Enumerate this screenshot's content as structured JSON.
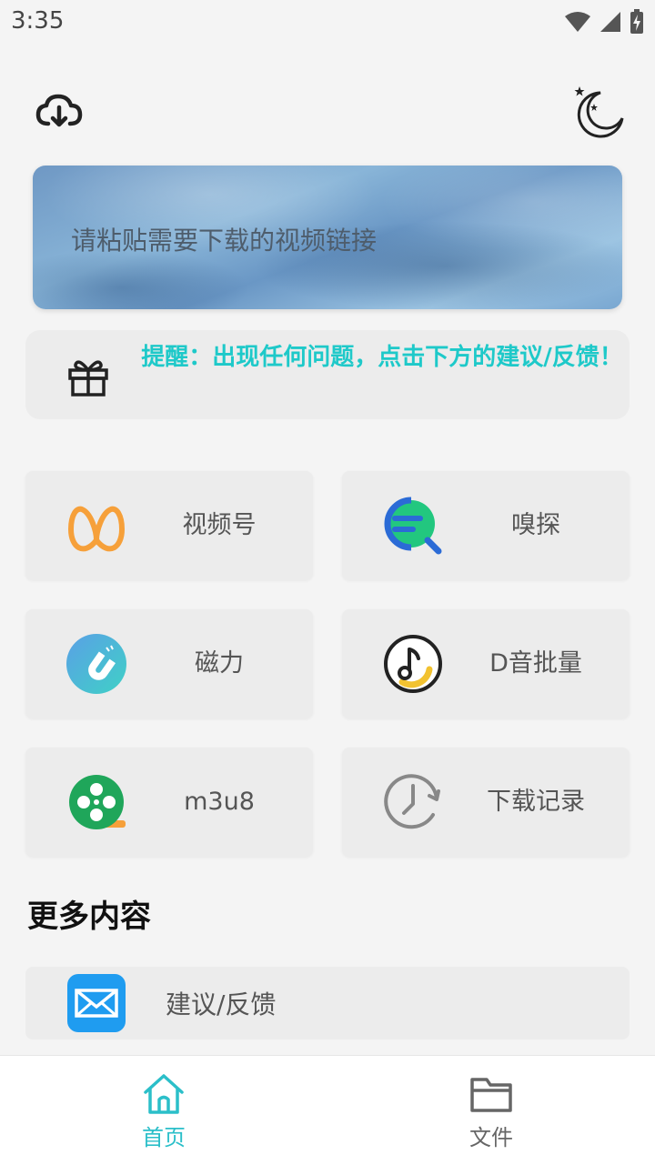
{
  "status_bar": {
    "time": "3:35"
  },
  "header": {
    "left_icon": "cloud-download-icon",
    "right_icon": "night-mode-moon-icon"
  },
  "search": {
    "placeholder": "请粘贴需要下载的视频链接",
    "value": ""
  },
  "notice": {
    "icon": "gift-icon",
    "text": "提醒：出现任何问题，点击下方的建议/反馈！",
    "color": "#1ec9c9"
  },
  "features": [
    {
      "label": "视频号",
      "icon": "channels-butterfly-icon"
    },
    {
      "label": "嗅探",
      "icon": "sniff-search-icon"
    },
    {
      "label": "磁力",
      "icon": "magnet-icon"
    },
    {
      "label": "D音批量",
      "icon": "music-note-icon"
    },
    {
      "label": "m3u8",
      "icon": "film-reel-icon"
    },
    {
      "label": "下载记录",
      "icon": "history-clock-icon"
    }
  ],
  "more": {
    "title": "更多内容",
    "items": [
      {
        "label": "建议/反馈",
        "icon": "mail-icon"
      }
    ]
  },
  "bottom_nav": {
    "items": [
      {
        "label": "首页",
        "icon": "home-icon",
        "active": true
      },
      {
        "label": "文件",
        "icon": "folder-icon",
        "active": false
      }
    ],
    "active_color": "#2bbfc9",
    "inactive_color": "#666666"
  }
}
